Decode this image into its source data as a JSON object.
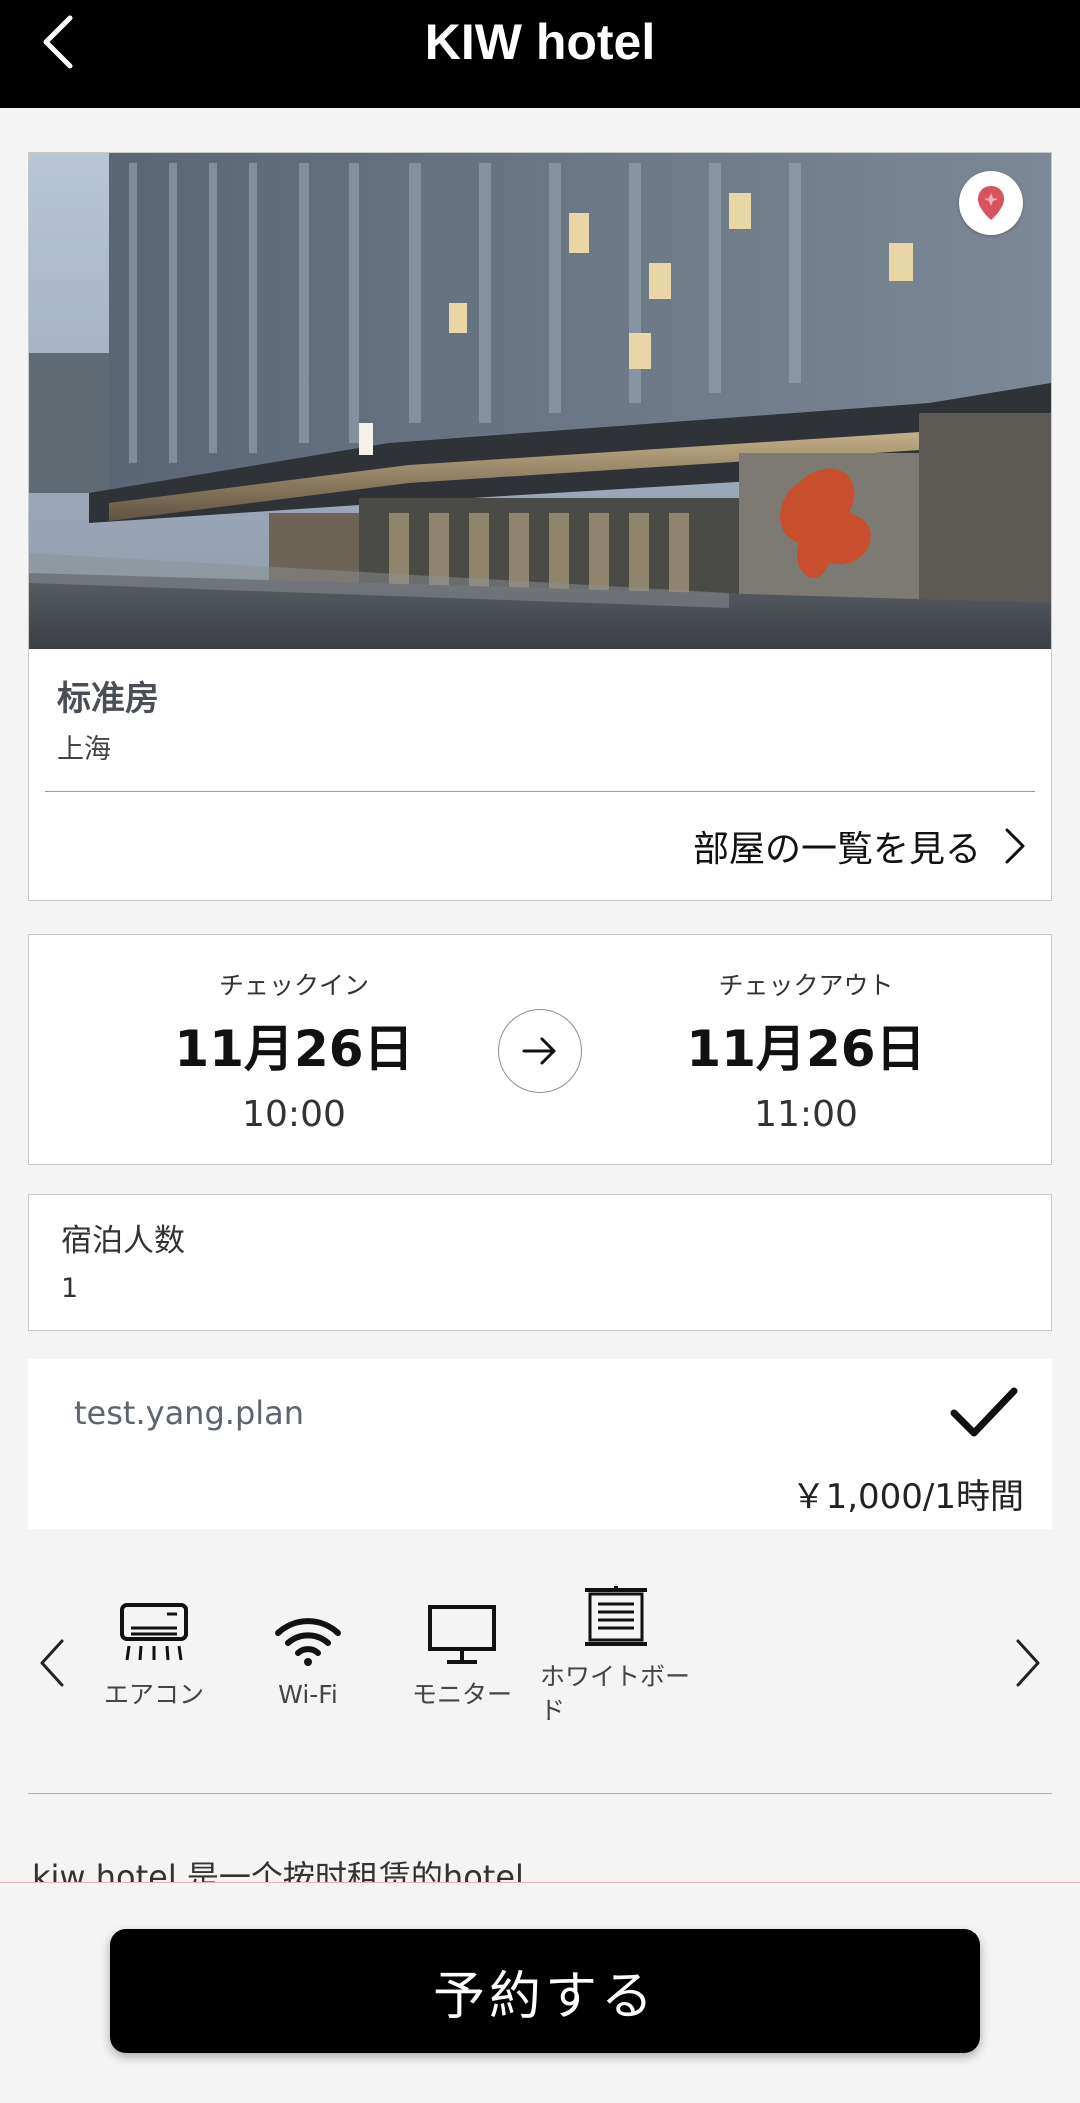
{
  "header": {
    "title": "KIW hotel"
  },
  "room": {
    "name": "标准房",
    "city": "上海",
    "room_list_link": "部屋の一覧を見る"
  },
  "stay": {
    "checkin_label": "チェックイン",
    "checkin_date": "11月26日",
    "checkin_time": "10:00",
    "checkout_label": "チェックアウト",
    "checkout_date": "11月26日",
    "checkout_time": "11:00"
  },
  "guests": {
    "label": "宿泊人数",
    "value": "1"
  },
  "plan": {
    "name": "test.yang.plan",
    "price": "￥1,000/1時間",
    "selected": true
  },
  "amenities": [
    {
      "icon": "air-conditioner-icon",
      "label": "エアコン"
    },
    {
      "icon": "wifi-icon",
      "label": "Wi-Fi"
    },
    {
      "icon": "monitor-icon",
      "label": "モニター"
    },
    {
      "icon": "whiteboard-icon",
      "label": "ホワイトボード"
    }
  ],
  "description": "kiw hotel 是一个按时租赁的hotel",
  "footer": {
    "book_button": "予約する"
  },
  "colors": {
    "header_bg": "#000000",
    "pin_red": "#d9535f",
    "button_bg": "#000000"
  }
}
